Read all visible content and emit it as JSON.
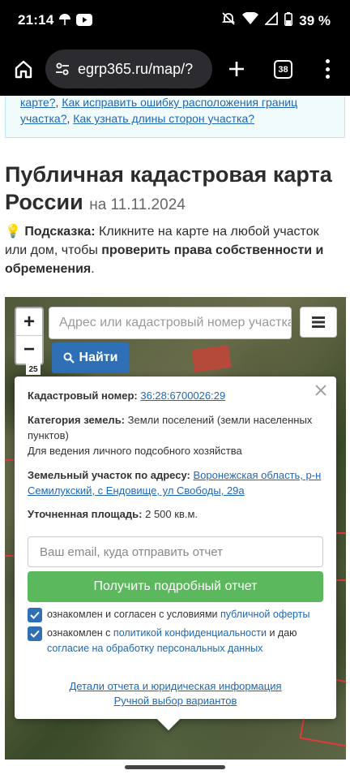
{
  "status_bar": {
    "time": "21:14",
    "battery": "39 %",
    "icons": [
      "umbrella-icon",
      "youtube-icon",
      "mute-icon",
      "wifi-icon",
      "signal-icon",
      "battery-icon"
    ]
  },
  "browser": {
    "url": "egrp365.ru/map/?",
    "tab_count": "38"
  },
  "info_links": {
    "link1": "карте?",
    "link2": "Как исправить ошибку расположения границ участка?",
    "link3": "Как узнать длины сторон участка?"
  },
  "heading": {
    "title": "Публичная кадастровая карта России",
    "date": "на 11.11.2024"
  },
  "hint": {
    "icon": "💡",
    "label": "Подсказка:",
    "text_before": "Кликните на карте на любой участок или дом, чтобы",
    "bold_text": "проверить права собственности и обременения",
    "text_after": "."
  },
  "map": {
    "zoom_in": "+",
    "zoom_out": "−",
    "search_placeholder": "Адрес или кадастровый номер участка",
    "find_label": "Найти",
    "scale_label": "25"
  },
  "popup": {
    "cadastral_label": "Кадастровый номер:",
    "cadastral_number": "36:28:6700026:29",
    "category_label": "Категория земель:",
    "category_value": "Земли поселений (земли населенных пунктов)",
    "usage": "Для ведения личного подсобного хозяйства",
    "address_label": "Земельный участок по адресу:",
    "address_value": "Воронежская область, р-н Семилукский, с Ендовище, ул Свободы, 29а",
    "area_label": "Уточненная площадь:",
    "area_value": "2 500 кв.м.",
    "email_placeholder": "Ваш email, куда отправить отчет",
    "report_button": "Получить подробный отчет",
    "check1_text": "ознакомлен и согласен с условиями",
    "check1_link": "публичной оферты",
    "check2_text_a": "ознакомлен с",
    "check2_link_a": "политикой конфиденциальности",
    "check2_text_b": "и даю",
    "check2_link_b": "согласие на обработку персональных данных",
    "link_details": "Детали отчета и юридическая информация",
    "link_manual": "Ручной выбор вариантов"
  },
  "colors": {
    "link": "#1f67b3",
    "find_button": "#2e6fb6",
    "report_button": "#5cb85c",
    "checkbox": "#2e6fb6"
  }
}
